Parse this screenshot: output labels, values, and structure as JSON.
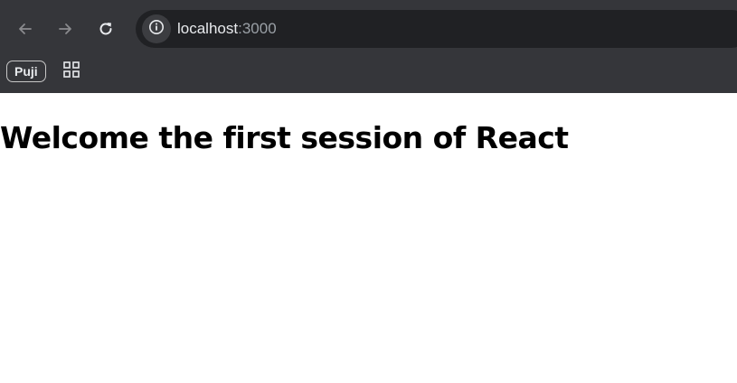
{
  "browser": {
    "url_host": "localhost",
    "url_port": ":3000",
    "icons": {
      "back": "arrow-left-icon",
      "forward": "arrow-right-icon",
      "reload": "reload-icon",
      "site_info": "info-icon",
      "apps": "apps-grid-icon"
    },
    "colors": {
      "chrome_bg": "#35363a",
      "omnibox_bg": "#202124",
      "text": "#e8eaed",
      "muted": "#9aa0a6"
    }
  },
  "bookmarks": {
    "items": [
      {
        "label": "Puji"
      }
    ]
  },
  "page": {
    "heading": "Welcome the first session of React"
  }
}
